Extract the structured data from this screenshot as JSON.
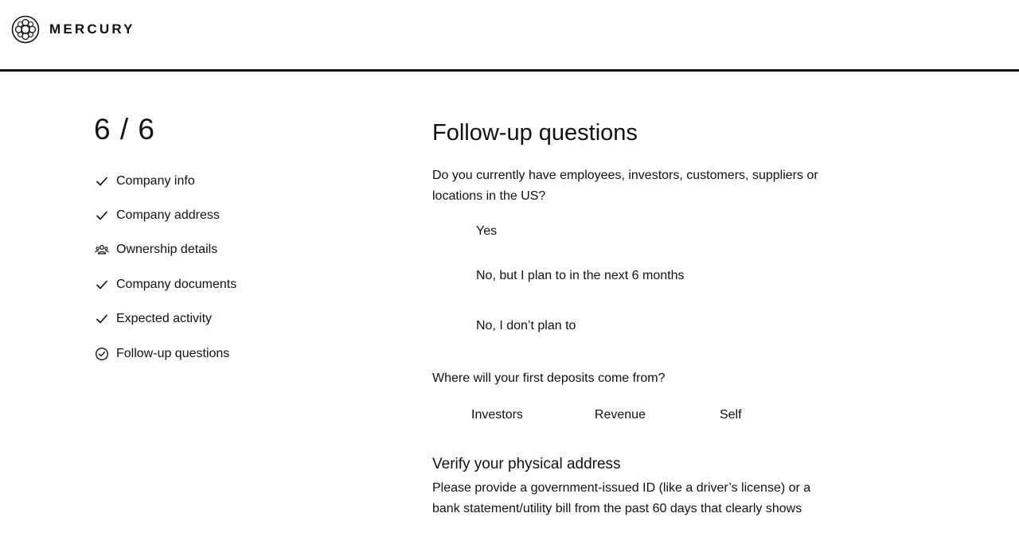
{
  "brand": {
    "name": "MERCURY"
  },
  "progress": {
    "counter": "6 / 6",
    "current": 6,
    "total": 6
  },
  "steps": [
    {
      "label": "Company info",
      "icon": "check-icon",
      "status": "complete"
    },
    {
      "label": "Company address",
      "icon": "check-icon",
      "status": "complete"
    },
    {
      "label": "Ownership details",
      "icon": "people-icon",
      "status": "incomplete"
    },
    {
      "label": "Company documents",
      "icon": "check-icon",
      "status": "complete"
    },
    {
      "label": "Expected activity",
      "icon": "check-icon",
      "status": "complete"
    },
    {
      "label": "Follow-up questions",
      "icon": "check-circle-icon",
      "status": "current"
    }
  ],
  "main": {
    "title": "Follow-up questions",
    "q1": {
      "text": "Do you currently have employees, investors, customers, suppliers or locations in the US?",
      "options": [
        "Yes",
        "No, but I plan to in the next 6 months",
        "No, I don’t plan to"
      ]
    },
    "q2": {
      "text": "Where will your first deposits come from?",
      "options": [
        "Investors",
        "Revenue",
        "Self"
      ]
    },
    "verify": {
      "title": "Verify your physical address",
      "body": "Please provide a government-issued ID (like a driver’s license) or a bank statement/utility bill from the past 60 days that clearly shows"
    }
  },
  "colors": {
    "text": "#111111",
    "background": "#ffffff",
    "divider": "#111111"
  }
}
